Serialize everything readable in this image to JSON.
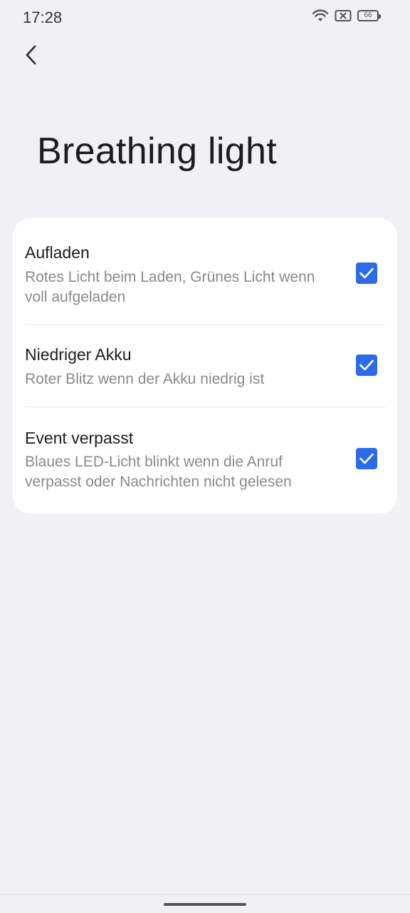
{
  "status_bar": {
    "time": "17:28",
    "battery_level": "66",
    "icons": [
      "wifi-icon",
      "sim-off-icon",
      "battery-icon"
    ]
  },
  "header": {
    "back_icon": "chevron-left-icon",
    "title": "Breathing light"
  },
  "settings": [
    {
      "title": "Aufladen",
      "description": "Rotes Licht beim Laden, Grünes Licht wenn voll aufgeladen",
      "checked": true
    },
    {
      "title": "Niedriger Akku",
      "description": "Roter Blitz wenn der Akku niedrig ist",
      "checked": true
    },
    {
      "title": "Event verpasst",
      "description": "Blaues LED-Licht blinkt wenn die Anruf verpasst oder Nachrichten nicht gelesen",
      "checked": true
    }
  ],
  "colors": {
    "background": "#f1f0f5",
    "card": "#ffffff",
    "accent": "#2b6be9",
    "secondary_text": "#8a8a8e"
  }
}
